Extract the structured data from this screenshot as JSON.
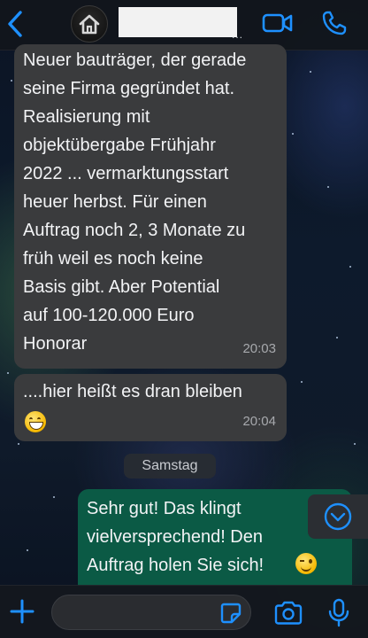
{
  "header": {
    "contact_dots": "...",
    "icons": {
      "back": "chevron-left-icon",
      "avatar": "house-icon",
      "video": "video-camera-icon",
      "call": "phone-icon"
    },
    "accent_color": "#1e90ff"
  },
  "messages": [
    {
      "direction": "incoming",
      "text": "Neuer bauträger, der gerade\nseine Firma gegründet hat.\nRealisierung mit\nobjektübergabe Frühjahr\n2022 ... vermarktungsstart\nheuer herbst. Für einen\nAuftrag noch 2, 3 Monate zu\nfrüh weil es noch keine\nBasis gibt.  Aber Potential\nauf 100-120.000 Euro\nHonorar",
      "time": "20:03"
    },
    {
      "direction": "incoming",
      "text": "....hier heißt es dran bleiben",
      "emoji": "grinning-face",
      "time": "20:04"
    },
    {
      "direction": "outgoing",
      "text": "Sehr gut! Das klingt\nvielversprechend! Den\nAuftrag holen Sie sich!",
      "emoji": "winking-face"
    }
  ],
  "date_separator": "Samstag",
  "composer": {
    "placeholder": "",
    "icons": {
      "plus": "plus-icon",
      "sticker": "sticker-icon",
      "camera": "camera-icon",
      "mic": "microphone-icon"
    }
  },
  "colors": {
    "incoming_bubble": "#3a3b3d",
    "outgoing_bubble": "#0b5a45"
  }
}
